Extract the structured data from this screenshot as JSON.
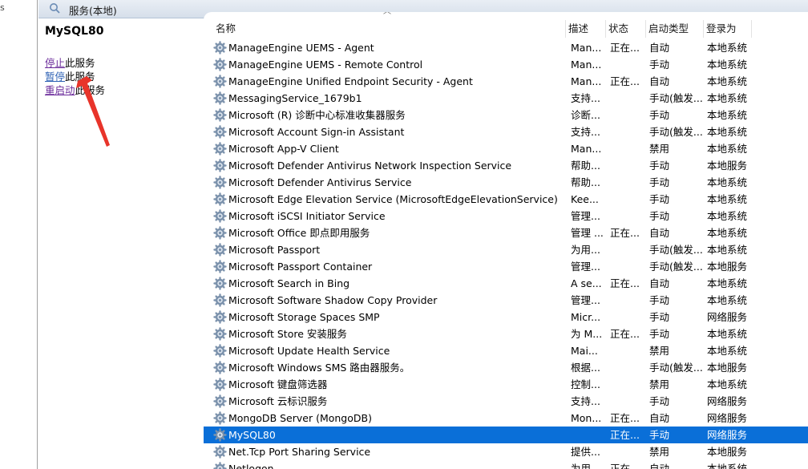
{
  "gutter_mark": "s",
  "header": {
    "title": "服务(本地)",
    "icon": "gear-services-icon"
  },
  "detail": {
    "service_name": "MySQL80",
    "actions": [
      {
        "link": "停止",
        "suffix": "此服务"
      },
      {
        "link": "暂停",
        "suffix": "此服务"
      },
      {
        "link": "重启动",
        "suffix": "此服务"
      }
    ],
    "annotation_color": "#e8342a"
  },
  "columns": {
    "name": "名称",
    "desc": "描述",
    "status": "状态",
    "start": "启动类型",
    "logon": "登录为"
  },
  "colors": {
    "selected": "#0a6fd8",
    "header_bg": "#dde5ef",
    "link": "#2b5fb3"
  },
  "services": [
    {
      "name": "ManageEngine UEMS - Agent",
      "desc": "Man...",
      "status": "正在...",
      "start": "自动",
      "logon": "本地系统"
    },
    {
      "name": "ManageEngine UEMS - Remote Control",
      "desc": "Man...",
      "status": "",
      "start": "手动",
      "logon": "本地系统"
    },
    {
      "name": "ManageEngine Unified Endpoint Security - Agent",
      "desc": "Man...",
      "status": "正在...",
      "start": "自动",
      "logon": "本地系统"
    },
    {
      "name": "MessagingService_1679b1",
      "desc": "支持...",
      "status": "",
      "start": "手动(触发...",
      "logon": "本地系统"
    },
    {
      "name": "Microsoft (R) 诊断中心标准收集器服务",
      "desc": "诊断...",
      "status": "",
      "start": "手动",
      "logon": "本地系统"
    },
    {
      "name": "Microsoft Account Sign-in Assistant",
      "desc": "支持...",
      "status": "",
      "start": "手动(触发...",
      "logon": "本地系统"
    },
    {
      "name": "Microsoft App-V Client",
      "desc": "Man...",
      "status": "",
      "start": "禁用",
      "logon": "本地系统"
    },
    {
      "name": "Microsoft Defender Antivirus Network Inspection Service",
      "desc": "帮助...",
      "status": "",
      "start": "手动",
      "logon": "本地服务"
    },
    {
      "name": "Microsoft Defender Antivirus Service",
      "desc": "帮助...",
      "status": "",
      "start": "手动",
      "logon": "本地系统"
    },
    {
      "name": "Microsoft Edge Elevation Service (MicrosoftEdgeElevationService)",
      "desc": "Kee...",
      "status": "",
      "start": "手动",
      "logon": "本地系统"
    },
    {
      "name": "Microsoft iSCSI Initiator Service",
      "desc": "管理...",
      "status": "",
      "start": "手动",
      "logon": "本地系统"
    },
    {
      "name": "Microsoft Office 即点即用服务",
      "desc": "管理 ...",
      "status": "正在...",
      "start": "自动",
      "logon": "本地系统"
    },
    {
      "name": "Microsoft Passport",
      "desc": "为用...",
      "status": "",
      "start": "手动(触发...",
      "logon": "本地系统"
    },
    {
      "name": "Microsoft Passport Container",
      "desc": "管理...",
      "status": "",
      "start": "手动(触发...",
      "logon": "本地服务"
    },
    {
      "name": "Microsoft Search in Bing",
      "desc": "A se...",
      "status": "正在...",
      "start": "自动",
      "logon": "本地系统"
    },
    {
      "name": "Microsoft Software Shadow Copy Provider",
      "desc": "管理...",
      "status": "",
      "start": "手动",
      "logon": "本地系统"
    },
    {
      "name": "Microsoft Storage Spaces SMP",
      "desc": "Micr...",
      "status": "",
      "start": "手动",
      "logon": "网络服务"
    },
    {
      "name": "Microsoft Store 安装服务",
      "desc": "为 M...",
      "status": "正在...",
      "start": "手动",
      "logon": "本地系统"
    },
    {
      "name": "Microsoft Update Health Service",
      "desc": "Mai...",
      "status": "",
      "start": "禁用",
      "logon": "本地系统"
    },
    {
      "name": "Microsoft Windows SMS 路由器服务。",
      "desc": "根据...",
      "status": "",
      "start": "手动(触发...",
      "logon": "本地服务"
    },
    {
      "name": "Microsoft 键盘筛选器",
      "desc": "控制...",
      "status": "",
      "start": "禁用",
      "logon": "本地系统"
    },
    {
      "name": "Microsoft 云标识服务",
      "desc": "支持...",
      "status": "",
      "start": "手动",
      "logon": "网络服务"
    },
    {
      "name": "MongoDB Server (MongoDB)",
      "desc": "Mon...",
      "status": "正在...",
      "start": "自动",
      "logon": "网络服务"
    },
    {
      "name": "MySQL80",
      "desc": "",
      "status": "正在...",
      "start": "手动",
      "logon": "网络服务",
      "selected": true
    },
    {
      "name": "Net.Tcp Port Sharing Service",
      "desc": "提供...",
      "status": "",
      "start": "禁用",
      "logon": "本地服务"
    },
    {
      "name": "Netlogon",
      "desc": "为用...",
      "status": "正在...",
      "start": "自动",
      "logon": "本地系统"
    }
  ]
}
